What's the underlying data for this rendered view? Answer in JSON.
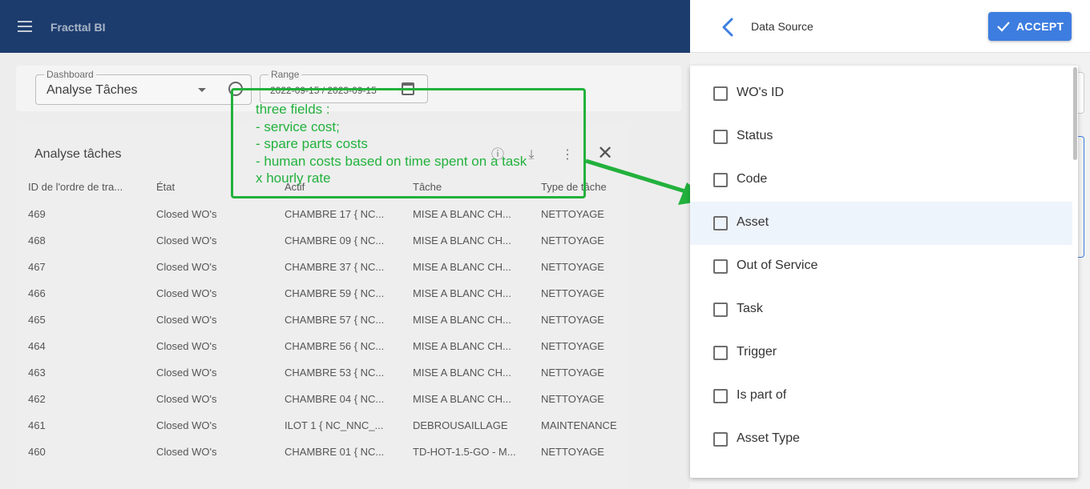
{
  "app": {
    "brand": "Fracttal BI"
  },
  "filters": {
    "dashboard_label": "Dashboard",
    "dashboard_value": "Analyse Tâches",
    "range_label": "Range",
    "range_value": "2022-09-15 / 2023-09-15"
  },
  "table": {
    "title": "Analyse tâches",
    "headers": [
      "ID de l'ordre de tra...",
      "État",
      "Actif",
      "Tâche",
      "Type de tâche"
    ],
    "rows": [
      [
        "469",
        "Closed WO's",
        "CHAMBRE 17 { NC...",
        "MISE A BLANC CH...",
        "NETTOYAGE"
      ],
      [
        "468",
        "Closed WO's",
        "CHAMBRE 09 { NC...",
        "MISE A BLANC CH...",
        "NETTOYAGE"
      ],
      [
        "467",
        "Closed WO's",
        "CHAMBRE 37 { NC...",
        "MISE A BLANC CH...",
        "NETTOYAGE"
      ],
      [
        "466",
        "Closed WO's",
        "CHAMBRE 59 { NC...",
        "MISE A BLANC CH...",
        "NETTOYAGE"
      ],
      [
        "465",
        "Closed WO's",
        "CHAMBRE 57 { NC...",
        "MISE A BLANC CH...",
        "NETTOYAGE"
      ],
      [
        "464",
        "Closed WO's",
        "CHAMBRE 56 { NC...",
        "MISE A BLANC CH...",
        "NETTOYAGE"
      ],
      [
        "463",
        "Closed WO's",
        "CHAMBRE 53 { NC...",
        "MISE A BLANC CH...",
        "NETTOYAGE"
      ],
      [
        "462",
        "Closed WO's",
        "CHAMBRE 04 { NC...",
        "MISE A BLANC CH...",
        "NETTOYAGE"
      ],
      [
        "461",
        "Closed WO's",
        "ILOT 1 { NC_NNC_...",
        "DEBROUSAILLAGE",
        "MAINTENANCE"
      ],
      [
        "460",
        "Closed WO's",
        "CHAMBRE 01 { NC...",
        "TD-HOT-1.5-GO - M...",
        "NETTOYAGE"
      ]
    ]
  },
  "annotation": {
    "lines": [
      "three fields :",
      "- service cost;",
      "- spare parts costs",
      "- human costs based on time spent on a task",
      "x hourly rate"
    ],
    "color": "#22b13c"
  },
  "panel": {
    "title": "Data Source",
    "accept_label": "ACCEPT",
    "options": [
      "WO's ID",
      "Status",
      "Code",
      "Asset",
      "Out of Service",
      "Task",
      "Trigger",
      "Is part of",
      "Asset Type"
    ],
    "highlighted_index": 3
  },
  "colors": {
    "appbar": "#1d3c6e",
    "accent": "#3d7de0"
  },
  "icons": {
    "menu": "hamburger-icon",
    "back": "chevron-left-icon",
    "accept": "check-icon",
    "info": "info-icon",
    "download": "download-icon",
    "more": "more-vert-icon",
    "close": "close-icon",
    "calendar": "calendar-icon"
  }
}
